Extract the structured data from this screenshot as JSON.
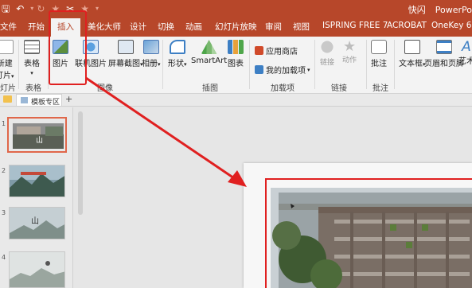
{
  "quick_access": {
    "save_icon": "save-icon",
    "undo_icon": "undo-icon",
    "redo_icon": "redo-icon",
    "star_icon": "star-icon",
    "brush_icon": "format-painter-icon",
    "dropdown_icon": "chevron-down-icon"
  },
  "window": {
    "user": "快闪",
    "app_name": "PowerPo"
  },
  "tabs": [
    {
      "label": "文件"
    },
    {
      "label": "开始"
    },
    {
      "label": "插入"
    },
    {
      "label": "美化大师"
    },
    {
      "label": "设计"
    },
    {
      "label": "切换"
    },
    {
      "label": "动画"
    },
    {
      "label": "幻灯片放映"
    },
    {
      "label": "审阅"
    },
    {
      "label": "视图"
    },
    {
      "label": "ISPRING FREE 7"
    },
    {
      "label": "ACROBAT"
    },
    {
      "label": "OneKey 6"
    }
  ],
  "ribbon": {
    "new_slide_top": "新建",
    "new_slide_bottom": "灯片",
    "slides_group": "灯片",
    "table": "表格",
    "tables_group": "表格",
    "picture": "图片",
    "online_picture": "联机图片",
    "screenshot": "屏幕截图",
    "album": "相册",
    "images_group": "图像",
    "shapes": "形状",
    "smartart": "SmartArt",
    "chart": "图表",
    "illustrations_group": "插图",
    "app_store": "应用商店",
    "my_addins": "我的加载项",
    "addins_group": "加载项",
    "link": "链接",
    "action": "动作",
    "links_group": "链接",
    "comment": "批注",
    "comments_group": "批注",
    "textbox": "文本框",
    "header_footer": "页眉和页脚",
    "wordart": "艺术"
  },
  "file_tab": {
    "label": "模板专区",
    "add": "+"
  },
  "slides": [
    {
      "num": "1"
    },
    {
      "num": "2"
    },
    {
      "num": "3"
    },
    {
      "num": "4"
    }
  ],
  "colors": {
    "accent": "#b7472a",
    "highlight": "#e02020"
  }
}
